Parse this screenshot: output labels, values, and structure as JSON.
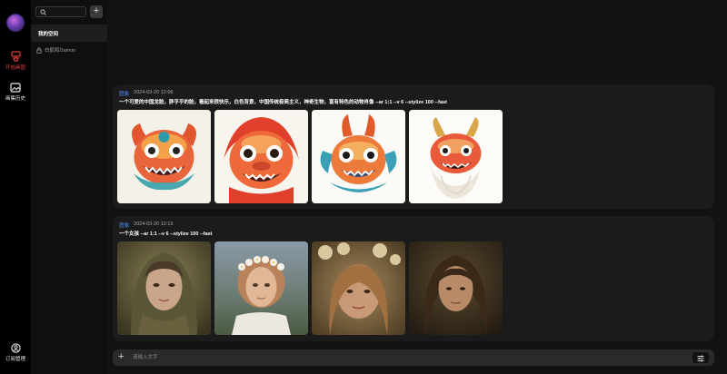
{
  "rail": {
    "items": [
      {
        "label": "开始画图",
        "icon": "brush-icon",
        "active": true
      },
      {
        "label": "画集历史",
        "icon": "gallery-icon",
        "active": false
      }
    ],
    "bottom": {
      "label": "订阅管理",
      "icon": "user-circle-icon"
    }
  },
  "sidebar": {
    "search": {
      "placeholder": ""
    },
    "add_label": "+",
    "space_label": "我的空间",
    "user_label": "白鹤和Damon"
  },
  "cards": [
    {
      "tag": "图像",
      "time": "2024-03-20 12:06",
      "prompt": "一个可爱的中国龙脸，胖乎乎的脸，看起来很快乐，白色背景，中国传统极简主义，神奇生物，富有特色的动物肖像 --ar 1:1 --v 6 --stylize 100 --fast"
    },
    {
      "tag": "图像",
      "time": "2024-03-20 12:13",
      "prompt": "一个女孩 --ar 1:1 --v 6 --stylize 100 --fast"
    }
  ],
  "input": {
    "placeholder": "请输入文字",
    "plus": "+"
  },
  "colors": {
    "accent_red": "#e03a3a",
    "tag_blue": "#4a8dff"
  }
}
